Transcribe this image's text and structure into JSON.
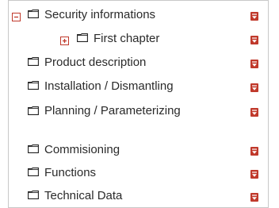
{
  "tree": {
    "items": [
      {
        "label": "Security informations",
        "expand_state": "expanded",
        "toggle_icon": "minus-icon",
        "icon": "folder-icon",
        "menu_icon": "dropdown-menu-icon"
      },
      {
        "label": "First chapter",
        "expand_state": "collapsed",
        "toggle_icon": "plus-icon",
        "icon": "folder-icon",
        "menu_icon": "dropdown-menu-icon"
      },
      {
        "label": "Product description",
        "icon": "folder-icon",
        "menu_icon": "dropdown-menu-icon"
      },
      {
        "label": "Installation / Dismantling",
        "icon": "folder-icon",
        "menu_icon": "dropdown-menu-icon"
      },
      {
        "label": "Planning / Parameterizing",
        "icon": "folder-icon",
        "menu_icon": "dropdown-menu-icon"
      },
      {
        "label": "Commisioning",
        "icon": "folder-icon",
        "menu_icon": "dropdown-menu-icon"
      },
      {
        "label": "Functions",
        "icon": "folder-icon",
        "menu_icon": "dropdown-menu-icon"
      },
      {
        "label": "Technical Data",
        "icon": "folder-icon",
        "menu_icon": "dropdown-menu-icon"
      }
    ]
  },
  "colors": {
    "accent": "#c0392b",
    "text": "#2a2a2a",
    "border": "#c8c8c8"
  }
}
